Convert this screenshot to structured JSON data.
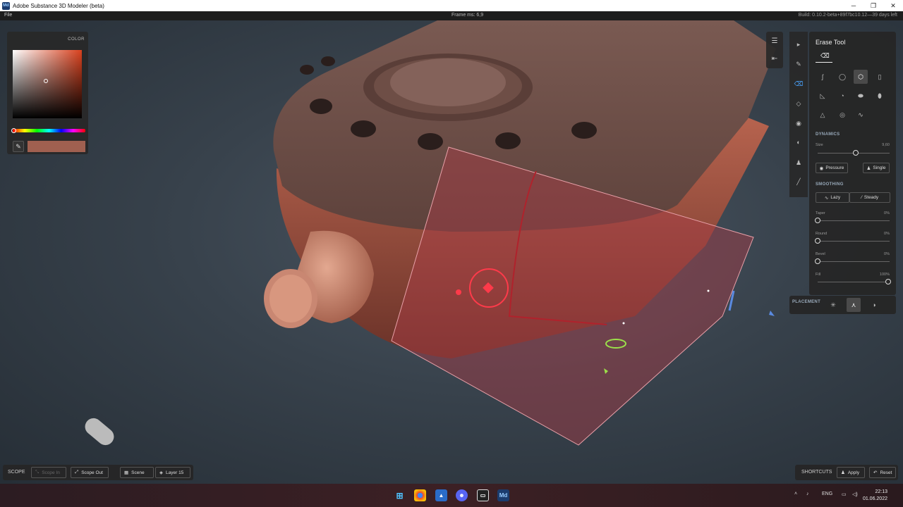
{
  "window": {
    "title": "Adobe Substance 3D Modeler (beta)",
    "app_icon": "Md",
    "controls": [
      "minimize-icon",
      "maximize-icon",
      "close-icon"
    ]
  },
  "menubar": {
    "file": "File",
    "frame_ms": "Frame ms: 6,9",
    "build": "Build: 0.10.2-beta+89f7bc10.12—39 days left"
  },
  "color_panel": {
    "title": "COLOR",
    "swatch_color": "#a06050",
    "picker_icon": "eyedropper-icon"
  },
  "vertical_toolbar": {
    "tools": [
      "select-icon",
      "clay-icon",
      "erase-icon",
      "smooth-icon",
      "inflate-icon",
      "flatten-icon",
      "stamp-icon",
      "paint-icon"
    ],
    "active": "erase-icon"
  },
  "side_toolbar": [
    "layers-icon",
    "undo-icon"
  ],
  "erase_tool": {
    "title": "Erase Tool",
    "tab_icon": "eraser-icon",
    "brush_icons": [
      "stroke-icon",
      "sphere-icon",
      "cube-icon",
      "cylinder-icon",
      "cone-icon",
      "drop-icon",
      "capsule-icon",
      "egg-icon",
      "pyramid-icon",
      "torus-icon",
      "curve-icon"
    ],
    "active_brush": "cube-icon",
    "dynamics": {
      "section": "DYNAMICS",
      "size_label": "Size",
      "size_value": "9,60",
      "size_fraction": 0.52,
      "pressure": "Pressure",
      "single": "Single"
    },
    "smoothing": {
      "section": "SMOOTHING",
      "lazy": "Lazy",
      "steady": "Steady",
      "taper_label": "Taper",
      "taper_value": "0%",
      "round_label": "Round",
      "round_value": "0%",
      "bevel_label": "Bevel",
      "bevel_value": "0%",
      "fill_label": "Fill",
      "fill_value": "100%"
    }
  },
  "placement": {
    "label": "PLACEMENT",
    "options": [
      "sun-icon",
      "surface-icon",
      "screen-icon"
    ],
    "active": "surface-icon"
  },
  "bottom": {
    "scope": "SCOPE",
    "scope_in": "Scope In",
    "scope_out": "Scope Out",
    "scene": "Scene",
    "layer": "Layer 15",
    "shortcuts": "SHORTCUTS",
    "apply": "Apply",
    "reset": "Reset"
  },
  "taskbar": {
    "apps": [
      "windows-start-icon",
      "chrome-icon",
      "photos-icon",
      "discord-icon",
      "terminal-icon",
      "modeler-icon"
    ],
    "modeler_label": "Md",
    "language": "ENG",
    "time": "22:13",
    "date": "01.06.2022"
  }
}
